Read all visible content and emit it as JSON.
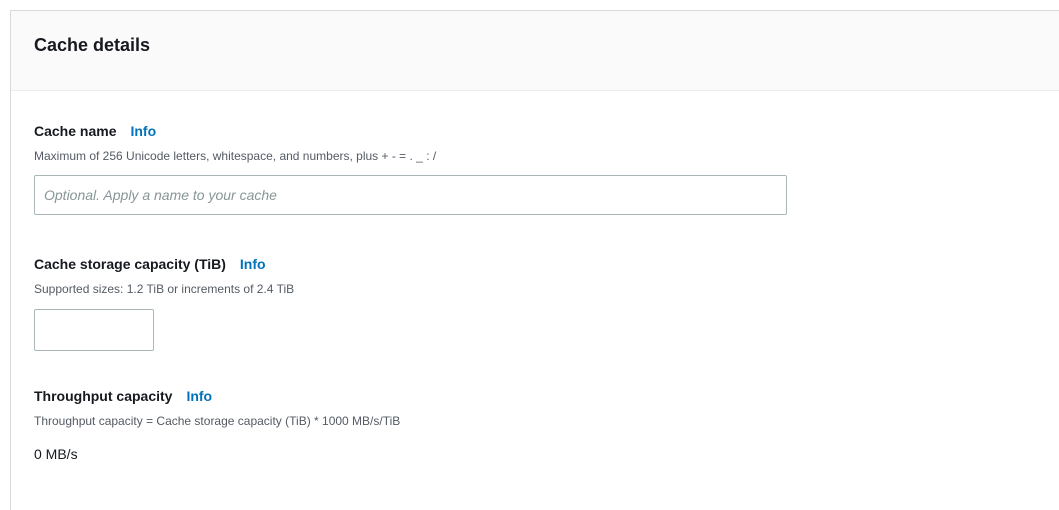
{
  "panel": {
    "title": "Cache details"
  },
  "cache_name": {
    "label": "Cache name",
    "info": "Info",
    "description": "Maximum of 256 Unicode letters, whitespace, and numbers, plus + - = . _ : /",
    "value": "",
    "placeholder": "Optional. Apply a name to your cache"
  },
  "storage_capacity": {
    "label": "Cache storage capacity (TiB)",
    "info": "Info",
    "description": "Supported sizes: 1.2 TiB or increments of 2.4 TiB",
    "value": ""
  },
  "throughput_capacity": {
    "label": "Throughput capacity",
    "info": "Info",
    "description": "Throughput capacity = Cache storage capacity (TiB) * 1000 MB/s/TiB",
    "value": "0 MB/s"
  }
}
